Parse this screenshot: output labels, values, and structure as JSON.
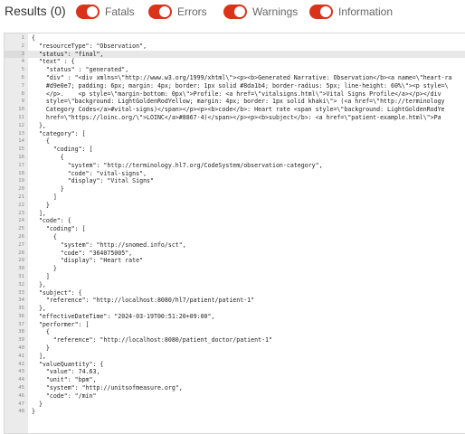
{
  "header": {
    "results_label": "Results (0)",
    "toggles": [
      {
        "label": "Fatals",
        "on": true
      },
      {
        "label": "Errors",
        "on": true
      },
      {
        "label": "Warnings",
        "on": true
      },
      {
        "label": "Information",
        "on": true
      }
    ]
  },
  "colors": {
    "toggle_on": "#d9331a",
    "gutter": "#ebebeb",
    "active_line": "#e8e8e8"
  },
  "editor": {
    "active_line": 3,
    "lines": [
      "{",
      "  \"resourceType\": \"Observation\",",
      "  \"status\": \"final\",",
      "  \"text\" : {",
      "    \"status\" : \"generated\",",
      "    \"div\" : \"<div xmlns=\\\"http://www.w3.org/1999/xhtml\\\"><p><b>Generated Narrative: Observation</b><a name=\\\"heart-ra",
      "    #d9e0e7; padding: 6px; margin: 4px; border: 1px solid #8da1b4; border-radius: 5px; line-height: 60%\\\"><p style=\\",
      "    </p>.    <p style=\\\"margin-bottom: 0px\\\">Profile: <a href=\\\"vitalsigns.html\\\">Vital Signs Profile</a></p></div",
      "    style=\\\"background: LightGoldenRodYellow; margin: 4px; border: 1px solid khaki\\\"> (<a href=\\\"http://terminology",
      "    Category Codes</a>#vital-signs)</span></p><p><b>code</b>: Heart rate <span style=\\\"background: LightGoldenRodYe",
      "    href=\\\"https://loinc.org/\\\">LOINC</a>#8867-4)</span></p><p><b>subject</b>: <a href=\\\"patient-example.html\\\">Pa",
      "  },",
      "  \"category\": [",
      "    {",
      "      \"coding\": [",
      "        {",
      "          \"system\": \"http://terminology.hl7.org/CodeSystem/observation-category\",",
      "          \"code\": \"vital-signs\",",
      "          \"display\": \"Vital Signs\"",
      "        }",
      "      ]",
      "    }",
      "  ],",
      "  \"code\": {",
      "    \"coding\": [",
      "      {",
      "        \"system\": \"http://snomed.info/sct\",",
      "        \"code\": \"364075005\",",
      "        \"display\": \"Heart rate\"",
      "      }",
      "    ]",
      "  },",
      "  \"subject\": {",
      "    \"reference\": \"http://localhost:8080/hl7/patient/patient-1\"",
      "  },",
      "  \"effectiveDateTime\": \"2024-03-19T00:51:20+09:00\",",
      "  \"performer\": [",
      "    {",
      "      \"reference\": \"http://localhost:8080/patient_doctor/patient-1\"",
      "    }",
      "  ],",
      "  \"valueQuantity\": {",
      "    \"value\": 74.63,",
      "    \"unit\": \"bpm\",",
      "    \"system\": \"http://unitsofmeasure.org\",",
      "    \"code\": \"/min\"",
      "  }",
      "}"
    ]
  }
}
